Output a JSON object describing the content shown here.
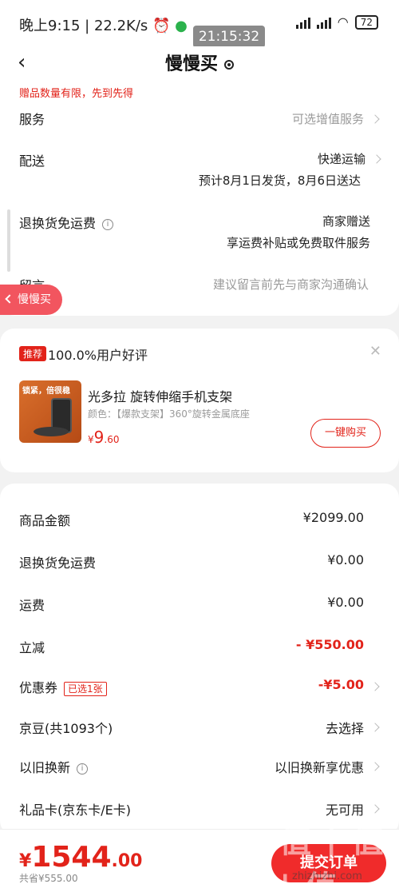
{
  "status": {
    "time": "晚上9:15",
    "speed": "22.2K/s",
    "battery": "72",
    "clock_overlay": "21:15:32"
  },
  "nav": {
    "title": "慢慢买"
  },
  "gift_notice": "赠品数量有限，先到先得",
  "service": {
    "label": "服务",
    "value": "可选增值服务"
  },
  "delivery": {
    "label": "配送",
    "method": "快递运输",
    "eta": "预计8月1日发货，8月6日送达"
  },
  "return_fee": {
    "label": "退换货免运费",
    "value": "商家赠送",
    "desc": "享运费补贴或免费取件服务"
  },
  "note": {
    "label": "留言",
    "placeholder": "建议留言前先与商家沟通确认"
  },
  "floating_back": "慢慢买",
  "recommend": {
    "tag": "推荐",
    "title": "100.0%用户好评",
    "thumb_text": "锁紧，倍很稳",
    "product_name": "光多拉 旋转伸缩手机支架",
    "spec": "颜色：【爆款支架】360°旋转金属底座",
    "price_yen": "¥",
    "price_int": "9",
    "price_dec": ".60",
    "buy_label": "一键购买"
  },
  "fees": [
    {
      "label": "商品金额",
      "value": "¥2099.00"
    },
    {
      "label": "退换货免运费",
      "value": "¥0.00"
    },
    {
      "label": "运费",
      "value": "¥0.00"
    },
    {
      "label": "立减",
      "value": "- ¥550.00"
    },
    {
      "label": "优惠券",
      "tag": "已选1张",
      "value": "-¥5.00"
    },
    {
      "label": "京豆(共1093个)",
      "value": "去选择"
    },
    {
      "label": "以旧换新",
      "value": "以旧换新享优惠"
    },
    {
      "label": "礼品卡(京东卡/E卡)",
      "value": "无可用"
    }
  ],
  "bottom": {
    "yen": "¥",
    "amount_int": "1544",
    "amount_dec": ".00",
    "saved": "共省¥555.00",
    "submit": "提交订单"
  },
  "watermark": {
    "text": "值 | 值 | 值",
    "site": "zhizhizhi.com"
  },
  "colors": {
    "accent": "#e2231a",
    "submit": "#f02b2b"
  }
}
